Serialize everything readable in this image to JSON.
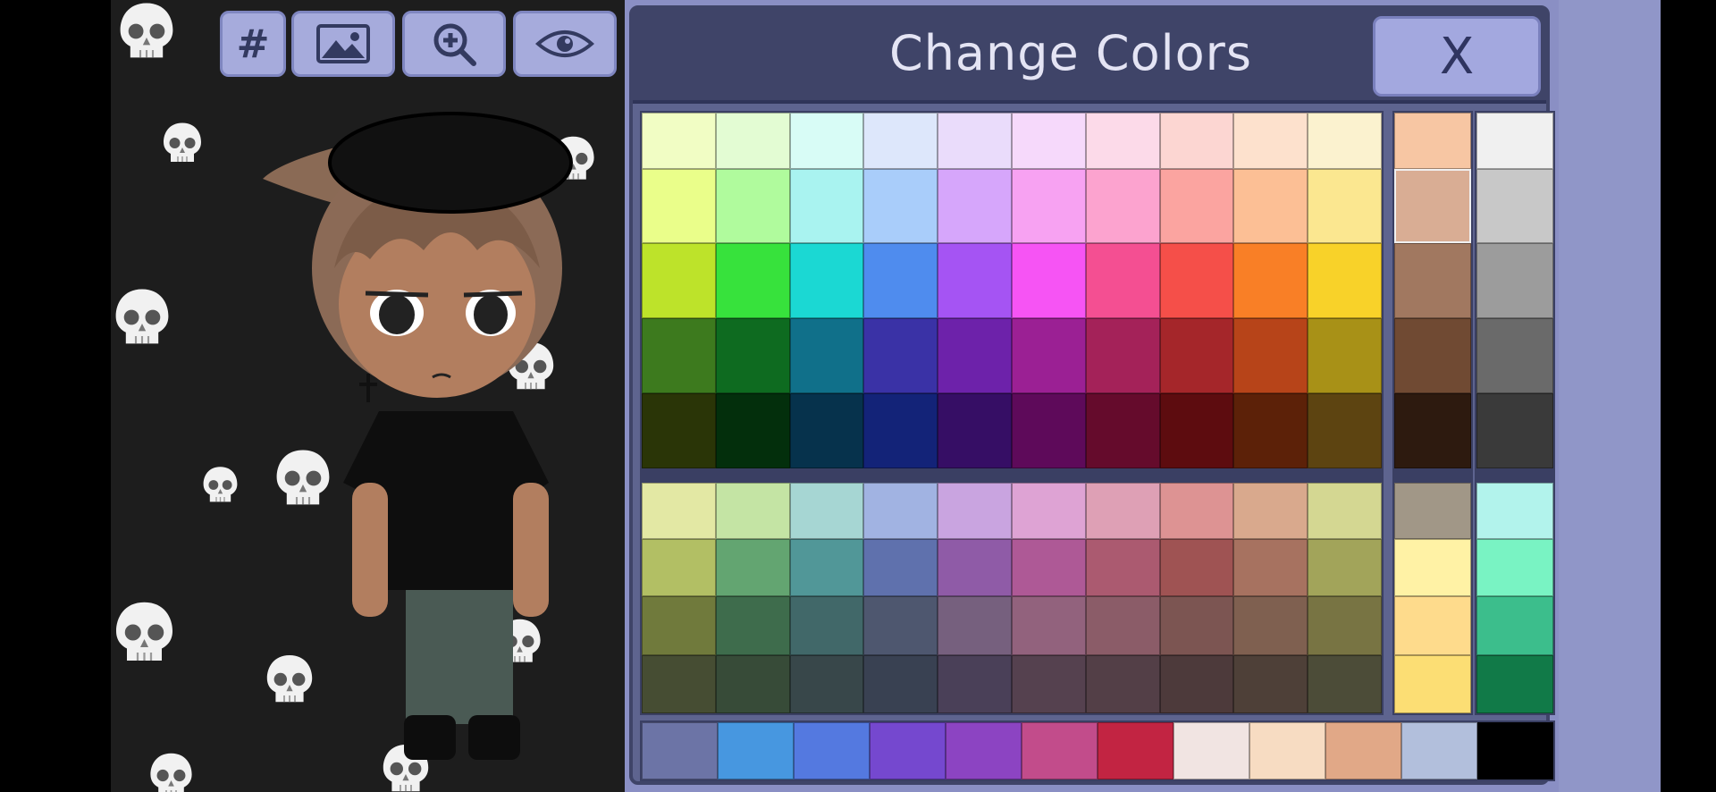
{
  "toolbar": {
    "buttons": [
      {
        "name": "hex-code-button",
        "icon": "hash-icon",
        "glyph": "#"
      },
      {
        "name": "background-image-button",
        "icon": "image-icon"
      },
      {
        "name": "zoom-in-button",
        "icon": "zoom-in-icon"
      },
      {
        "name": "visibility-button",
        "icon": "eye-icon"
      }
    ]
  },
  "dialog": {
    "title": "Change Colors",
    "close_label": "X"
  },
  "palette": {
    "main_rows": [
      [
        "#f1fdc4",
        "#e3fcd3",
        "#d8fcf6",
        "#dde7fb",
        "#eadcfb",
        "#f6d9fb",
        "#fcdae9",
        "#fcd6d2",
        "#fde1cd",
        "#fbf2cf"
      ],
      [
        "#eafe8a",
        "#b0fb9d",
        "#a9f3f0",
        "#a9cdfa",
        "#d6a6fb",
        "#f7a2f2",
        "#fca3cf",
        "#fba4a0",
        "#fcbf95",
        "#fbe790"
      ],
      [
        "#bde32a",
        "#37e23c",
        "#1bd8d3",
        "#4f8cee",
        "#a554f3",
        "#f654f4",
        "#f44f92",
        "#f54f49",
        "#f97f26",
        "#f8d229"
      ],
      [
        "#3d7a1e",
        "#0e6b20",
        "#10708a",
        "#3a32a6",
        "#6d22aa",
        "#9b2094",
        "#a42259",
        "#a5262a",
        "#b74419",
        "#a89117"
      ],
      [
        "#2a3507",
        "#032f0c",
        "#06324c",
        "#132378",
        "#360e65",
        "#5e0a5a",
        "#650b2c",
        "#5d0c0f",
        "#5c2108",
        "#5d4411"
      ]
    ],
    "skin_column": [
      "#f7c6a3",
      "#d9ad94",
      "#a17860",
      "#704a33",
      "#2d1a0f"
    ],
    "gray_column": [
      "#f0f0f0",
      "#c8c8c8",
      "#9c9c9c",
      "#6a6a6a",
      "#3a3a3a"
    ],
    "muted_rows": [
      [
        "#e3e8a4",
        "#c4e4a4",
        "#a6d6d3",
        "#a1b3e2",
        "#c9a4e0",
        "#dea3d4",
        "#dea0b5",
        "#dd9393",
        "#d9a98d",
        "#d4d792"
      ],
      [
        "#b2bf64",
        "#63a571",
        "#519798",
        "#5f71ad",
        "#8f5ba7",
        "#ae5996",
        "#ab5a70",
        "#9f5353",
        "#a77260",
        "#a2a45a"
      ],
      [
        "#707a3c",
        "#3e6c4c",
        "#416869",
        "#4e576f",
        "#76607e",
        "#92627d",
        "#8b5c68",
        "#7c5552",
        "#7f6050",
        "#787443"
      ],
      [
        "#464d33",
        "#374b38",
        "#38474a",
        "#394152",
        "#4a4058",
        "#55414f",
        "#533f47",
        "#4d3a3b",
        "#4e4038",
        "#4c4c38"
      ]
    ],
    "side_a_column": [
      "#a19787",
      "#fff2a5",
      "#fedb8c",
      "#fcde74"
    ],
    "side_b_column": [
      "#b2f3ec",
      "#79f3c3",
      "#3cbe8c",
      "#117a48"
    ],
    "bottom_row": [
      "#6c74a6",
      "#4797e0",
      "#5479e0",
      "#7548cf",
      "#8c44c2",
      "#c24c8b",
      "#c22442",
      "#f1e4e2",
      "#f7dcc2",
      "#e1a887",
      "#b2bfdc",
      "#000000"
    ]
  }
}
